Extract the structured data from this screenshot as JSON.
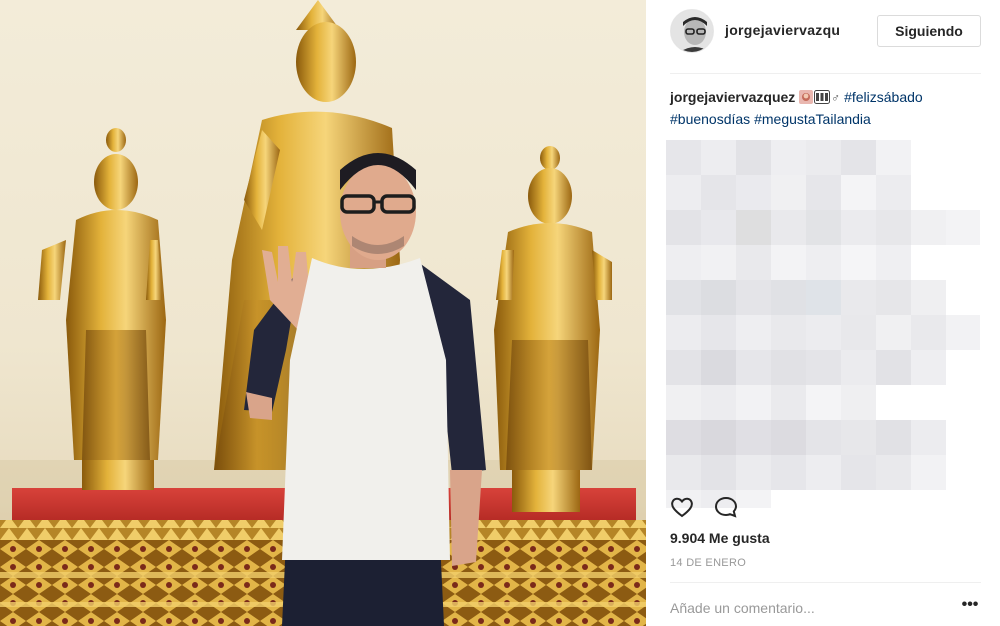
{
  "post": {
    "username": "jorgejaviervazqu",
    "follow_button_label": "Siguiendo",
    "caption": {
      "username": "jorgejaviervazquez",
      "emojis": [
        "woman-emoji",
        "ab-symbol-emoji",
        "male-sign-emoji"
      ],
      "male_sign": "♂",
      "hashtags_line1": "#felizsábado",
      "hashtags_line2": [
        "#buenosdías",
        "#megustaTailandia"
      ]
    },
    "likes_text": "9.904 Me gusta",
    "date_text": "14 DE ENERO",
    "comment_placeholder": "Añade un comentario...",
    "more_options_label": "•••"
  },
  "icons": {
    "avatar": "avatar",
    "like": "heart-icon",
    "comment": "comment-bubble-icon",
    "more": "more-options-icon"
  },
  "colors": {
    "hashtag": "#003569",
    "text": "#262626",
    "secondary_text": "#999999",
    "border": "#dbdbdb",
    "gold": "#d9a62a",
    "pedestal_red": "#c8312b",
    "wall": "#f3ecd9"
  }
}
